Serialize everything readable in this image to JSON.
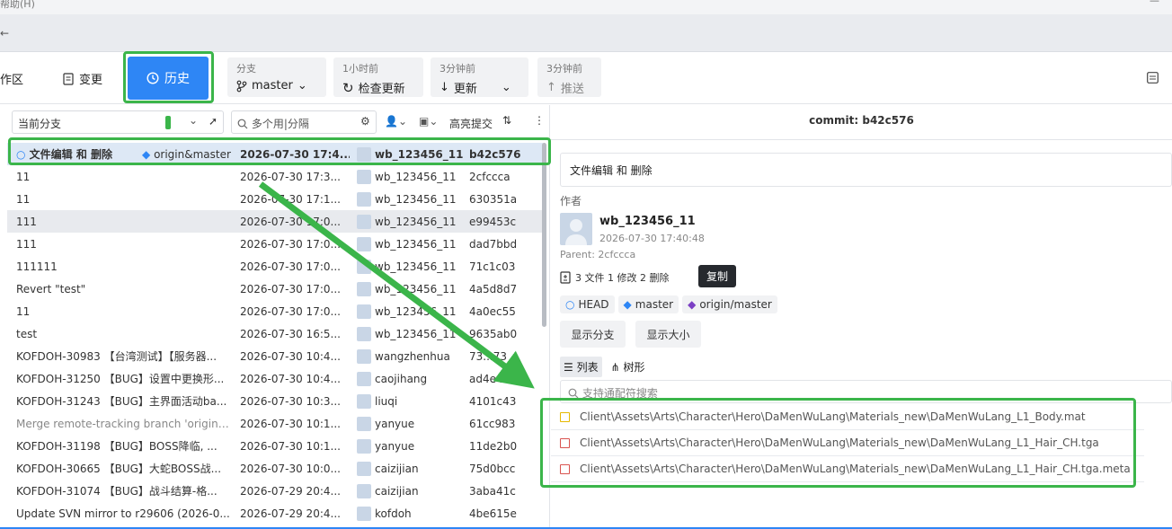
{
  "menubar": {
    "help": "帮助(H)",
    "minimize": "—"
  },
  "titlestrip": {
    "arrow": "←"
  },
  "toolbar": {
    "workspace_label": "作区",
    "changes_label": "变更",
    "history_label": "历史",
    "branch": {
      "small": "分支",
      "value": "master"
    },
    "fetch": {
      "small": "1小时前",
      "label": "检查更新"
    },
    "pull": {
      "small": "3分钟前",
      "label": "更新"
    },
    "push": {
      "small": "3分钟前",
      "label": "推送"
    }
  },
  "filters": {
    "branch_select": "当前分支",
    "search_placeholder": "多个用|分隔",
    "highlight_label": "高亮提交"
  },
  "commits": [
    {
      "msg": "文件编辑 和 删除",
      "tag": "origin&master",
      "date": "2026-07-30 17:4...",
      "author": "wb_123456_11",
      "hash": "b42c576"
    },
    {
      "msg": "11",
      "date": "2026-07-30 17:3...",
      "author": "wb_123456_11",
      "hash": "2cfccca"
    },
    {
      "msg": "11",
      "date": "2026-07-30 17:1...",
      "author": "wb_123456_11",
      "hash": "630351a"
    },
    {
      "msg": "111",
      "date": "2026-07-30 17:0...",
      "author": "wb_123456_11",
      "hash": "e99453c"
    },
    {
      "msg": "111",
      "date": "2026-07-30 17:0...",
      "author": "wb_123456_11",
      "hash": "dad7bbd"
    },
    {
      "msg": "111111",
      "date": "2026-07-30 17:0...",
      "author": "wb_123456_11",
      "hash": "71c1c03"
    },
    {
      "msg": "Revert \"test\"",
      "date": "2026-07-30 17:0...",
      "author": "wb_123456_11",
      "hash": "4a5d8d7"
    },
    {
      "msg": "11",
      "date": "2026-07-30 17:0...",
      "author": "wb_123456_11",
      "hash": "4a0ec55"
    },
    {
      "msg": "test",
      "date": "2026-07-30 16:5...",
      "author": "wb_123456_11",
      "hash": "9635ab0"
    },
    {
      "msg": "KOFDOH-30983 【台湾测试】【服务器...",
      "date": "2026-07-30 10:4...",
      "author": "wangzhenhua",
      "hash": "73...73"
    },
    {
      "msg": "KOFDOH-31250 【BUG】设置中更换形...",
      "date": "2026-07-30 10:4...",
      "author": "caojihang",
      "hash": "ad4e4..."
    },
    {
      "msg": "KOFDOH-31243 【BUG】主界面活动ba...",
      "date": "2026-07-30 10:3...",
      "author": "liuqi",
      "hash": "4101c43"
    },
    {
      "msg": "Merge remote-tracking branch 'origin/...",
      "date": "2026-07-30 10:1...",
      "author": "yanyue",
      "hash": "61cc983"
    },
    {
      "msg": "KOFDOH-31198 【BUG】BOSS降临, ...",
      "date": "2026-07-30 10:1...",
      "author": "yanyue",
      "hash": "11de2b0"
    },
    {
      "msg": "KOFDOH-30665 【BUG】大蛇BOSS战...",
      "date": "2026-07-30 10:0...",
      "author": "caizijian",
      "hash": "75d0bcc"
    },
    {
      "msg": "KOFDOH-31074 【BUG】战斗结算-格...",
      "date": "2026-07-29 20:4...",
      "author": "caizijian",
      "hash": "3aba41c"
    },
    {
      "msg": "Update SVN mirror to r29606 (2026-0...",
      "date": "2026-07-29 20:4...",
      "author": "kofdoh",
      "hash": "4be615e"
    }
  ],
  "detail": {
    "commit_title": "commit: b42c576",
    "message": "文件编辑 和 删除",
    "author_label": "作者",
    "author": "wb_123456_11",
    "datetime": "2026-07-30 17:40:48",
    "parent": "Parent: 2cfccca",
    "stats": "3 文件 1 修改 2 删除",
    "copy_tooltip": "复制",
    "refs": [
      "HEAD",
      "master",
      "origin/master"
    ],
    "show_branch": "显示分支",
    "show_size": "显示大小",
    "view_list": "列表",
    "view_tree": "树形",
    "file_search_placeholder": "支持通配符搜索",
    "files": [
      {
        "status": "modified",
        "path": "Client\\Assets\\Arts\\Character\\Hero\\DaMenWuLang\\Materials_new\\DaMenWuLang_L1_Body.mat"
      },
      {
        "status": "deleted",
        "path": "Client\\Assets\\Arts\\Character\\Hero\\DaMenWuLang\\Materials_new\\DaMenWuLang_L1_Hair_CH.tga"
      },
      {
        "status": "deleted",
        "path": "Client\\Assets\\Arts\\Character\\Hero\\DaMenWuLang\\Materials_new\\DaMenWuLang_L1_Hair_CH.tga.meta"
      }
    ]
  },
  "colors": {
    "accent": "#2e86f5",
    "highlight": "#3bb54a",
    "modified": "#e6b800",
    "deleted": "#d9534f"
  }
}
